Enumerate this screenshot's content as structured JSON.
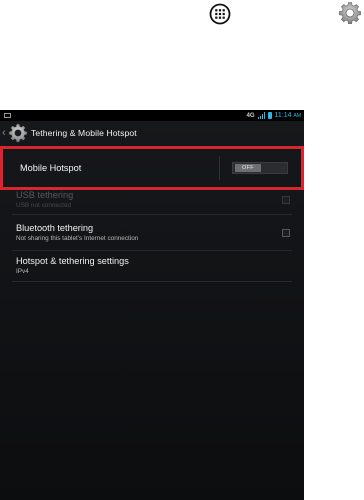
{
  "outer": {
    "icons": [
      "apps-grid-icon",
      "settings-gear-icon"
    ]
  },
  "status_bar": {
    "network": "4G",
    "time": "11:14",
    "time_suffix": "AM",
    "accent": "#33b5e5"
  },
  "action_bar": {
    "title": "Tethering & Mobile Hotspot"
  },
  "mobile_hotspot": {
    "label": "Mobile Hotspot",
    "toggle_state": "OFF",
    "highlight_color": "#d7262f"
  },
  "items": [
    {
      "title": "USB tethering",
      "subtitle": "USB not connected",
      "enabled": false,
      "checked": false
    },
    {
      "title": "Bluetooth tethering",
      "subtitle": "Not sharing this tablet's Internet connection",
      "enabled": true,
      "checked": false
    },
    {
      "title": "Hotspot & tethering settings",
      "subtitle": "IPv4",
      "enabled": true
    }
  ]
}
